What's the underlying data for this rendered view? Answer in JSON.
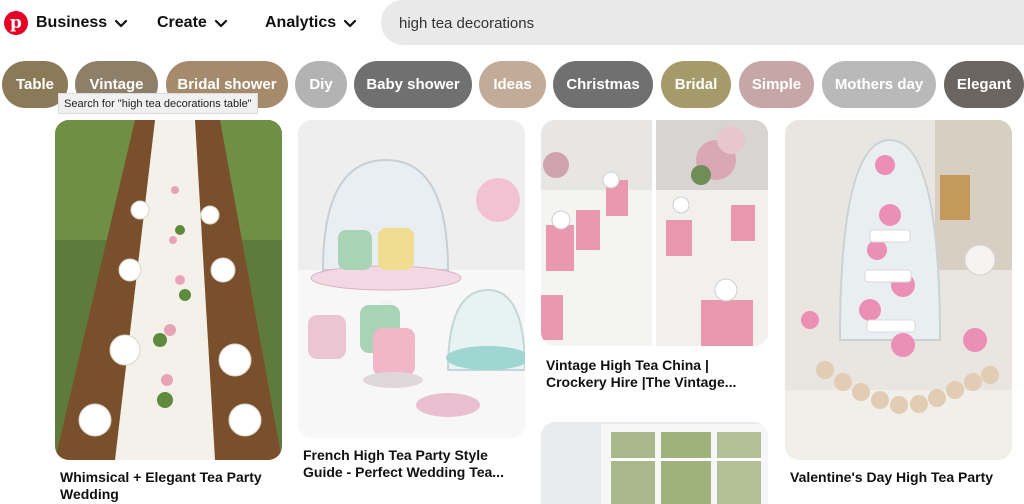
{
  "header": {
    "logo_letter": "p",
    "nav": [
      {
        "label": "Business"
      },
      {
        "label": "Create"
      },
      {
        "label": "Analytics"
      }
    ],
    "search": {
      "value": "high tea decorations"
    }
  },
  "chips": [
    {
      "label": "Table",
      "color": "#8b7a58"
    },
    {
      "label": "Vintage",
      "color": "#8e8068"
    },
    {
      "label": "Bridal shower",
      "color": "#a58a6c"
    },
    {
      "label": "Diy",
      "color": "#b3b3b3"
    },
    {
      "label": "Baby shower",
      "color": "#707070"
    },
    {
      "label": "Ideas",
      "color": "#c2ab98"
    },
    {
      "label": "Christmas",
      "color": "#707070"
    },
    {
      "label": "Bridal",
      "color": "#a49a6a"
    },
    {
      "label": "Simple",
      "color": "#c6a6a6"
    },
    {
      "label": "Mothers day",
      "color": "#b9b9b9"
    },
    {
      "label": "Elegant",
      "color": "#6a6560"
    }
  ],
  "tooltip": "Search for \"high tea decorations table\"",
  "pins": [
    {
      "title": "Whimsical + Elegant Tea Party Wedding"
    },
    {
      "title": "French High Tea Party Style Guide - Perfect Wedding Tea..."
    },
    {
      "title": "Vintage High Tea China | Crockery Hire |The Vintage..."
    },
    {
      "title": "Valentine's Day High Tea Party"
    }
  ]
}
